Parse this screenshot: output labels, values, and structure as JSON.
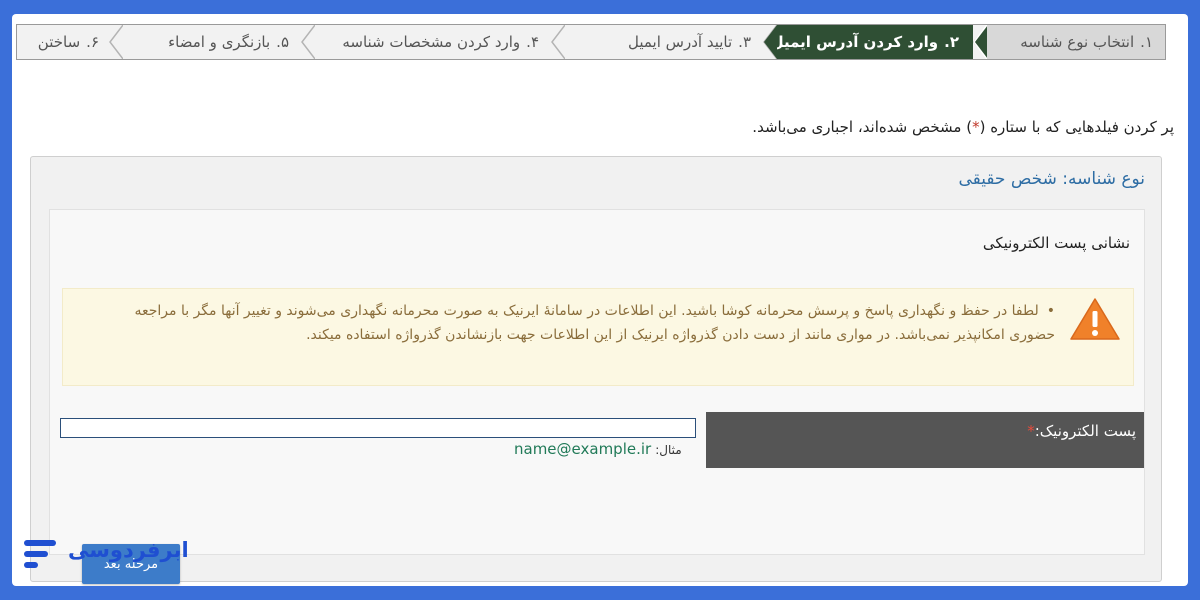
{
  "steps": [
    {
      "num": "۱.",
      "label": "انتخاب نوع شناسه",
      "state": "done"
    },
    {
      "num": "۲.",
      "label": "وارد کردن آدرس ایمیل",
      "state": "active"
    },
    {
      "num": "۳.",
      "label": "تایید آدرس ایمیل",
      "state": "todo"
    },
    {
      "num": "۴.",
      "label": "وارد کردن مشخصات شناسه",
      "state": "todo"
    },
    {
      "num": "۵.",
      "label": "بازنگری و امضاء",
      "state": "todo"
    },
    {
      "num": "۶.",
      "label": "ساختن",
      "state": "todo"
    }
  ],
  "note": {
    "before": "پر کردن فیلدهایی که با ستاره (",
    "star": "*",
    "after": ") مشخص شده‌اند، اجباری می‌باشد."
  },
  "panel": {
    "title": "نوع شناسه: شخص حقیقی",
    "section_title": "نشانی پست الکترونیکی",
    "alert": {
      "icon": "warning-triangle-icon",
      "text": "لطفا در حفظ و نگهداری پاسخ و پرسش محرمانه کوشا باشید. این اطلاعات در سامانهٔ ایرنیک به صورت محرمانه نگهداری می‌شوند و تغییر آنها مگر با مراجعه حضوری امکانپذیر نمی‌باشد. در مواری مانند از دست دادن گذرواژه ایرنیک از این اطلاعات جهت بازنشاندن گذرواژه استفاده میکند."
    },
    "email": {
      "label": "پست الکترونیک:",
      "required_mark": "*",
      "value": "",
      "example_prefix": "مثال:",
      "example": "name@example.ir"
    },
    "next_button": "مرحله بعد"
  },
  "brand": {
    "name": "ابرفردوسی",
    "icon": "brand-lines-icon"
  },
  "colors": {
    "background": "#3b6fd9",
    "active_step": "#2f4f34",
    "link_blue": "#2e6da4",
    "button": "#3d7cc9",
    "alert_bg": "#fcf8e3",
    "alert_text": "#8a6d3b",
    "label_bg": "#555555",
    "example_green": "#217a58",
    "required_red": "#e74c3c",
    "warning_orange": "#f0812a"
  }
}
